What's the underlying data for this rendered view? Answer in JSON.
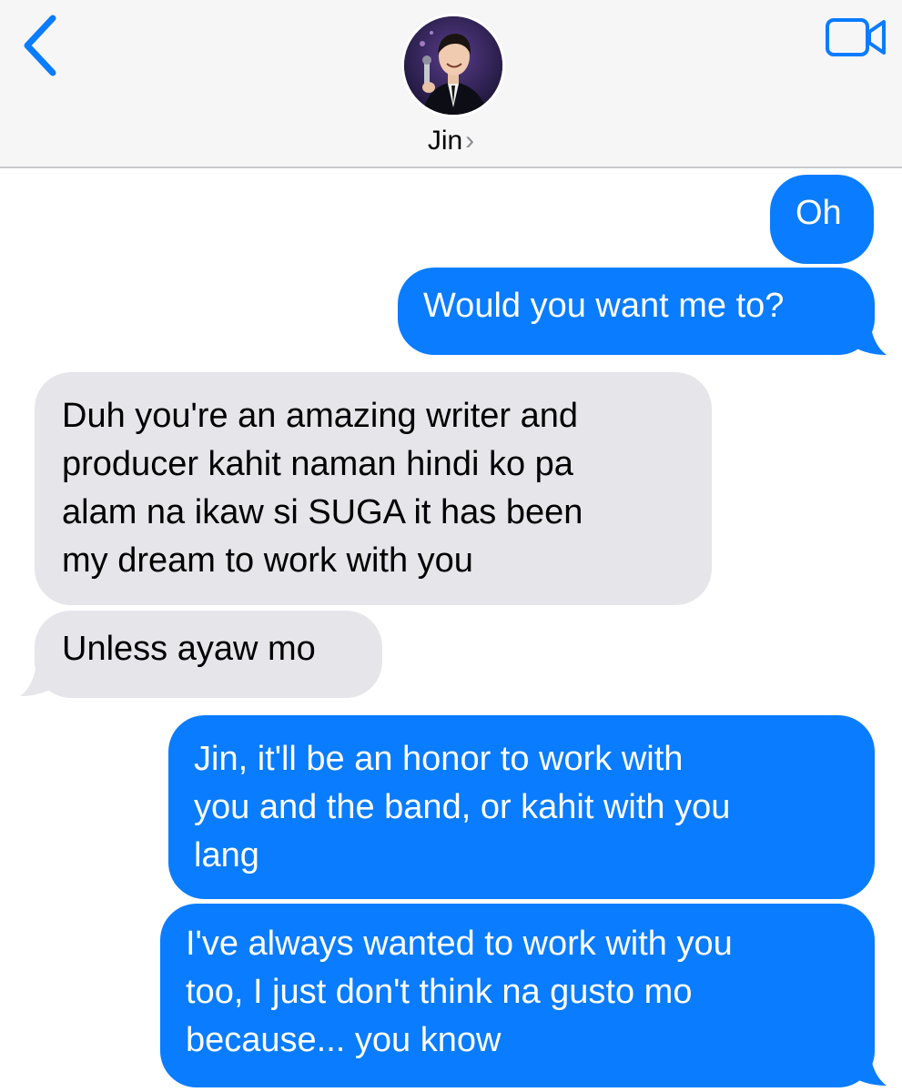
{
  "header": {
    "contact_name": "Jin",
    "chevron": "›",
    "back_icon": "chevron-left-icon",
    "video_icon": "video-camera-icon",
    "avatar_alt": "Jin",
    "accent_color": "#0a7cff"
  },
  "messages": [
    {
      "direction": "outgoing",
      "lines": [
        "Oh"
      ]
    },
    {
      "direction": "outgoing",
      "lines": [
        "Would you want me to?"
      ]
    },
    {
      "direction": "incoming",
      "lines": [
        "Duh you're an amazing writer and",
        "producer kahit naman hindi ko pa",
        "alam na ikaw si SUGA it has been",
        "my dream to work with you"
      ]
    },
    {
      "direction": "incoming",
      "lines": [
        "Unless ayaw mo"
      ]
    },
    {
      "direction": "outgoing",
      "lines": [
        "Jin, it'll be an honor to work with",
        "you and the band, or kahit with you",
        "lang"
      ]
    },
    {
      "direction": "outgoing",
      "lines": [
        "I've always wanted to work with you",
        "too, I just don't think na gusto mo",
        "because... you know"
      ]
    }
  ],
  "colors": {
    "outgoing_bubble": "#0a7cff",
    "incoming_bubble": "#e6e5ea",
    "header_bg": "#f6f6f7"
  }
}
